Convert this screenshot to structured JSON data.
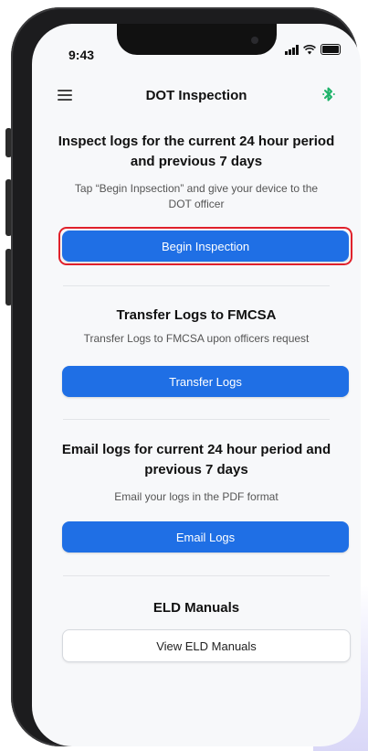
{
  "status_bar": {
    "time": "9:43"
  },
  "header": {
    "title": "DOT Inspection"
  },
  "inspection": {
    "heading": "Inspect logs for the current 24 hour period and previous 7 days",
    "description": "Tap “Begin Inpsection” and give your device to the DOT officer",
    "button_label": "Begin Inspection"
  },
  "transfer": {
    "heading": "Transfer Logs to FMCSA",
    "description": "Transfer Logs to FMCSA upon officers request",
    "button_label": "Transfer Logs"
  },
  "email": {
    "heading": "Email logs for current 24 hour period and previous 7 days",
    "description": "Email your logs in the PDF format",
    "button_label": "Email Logs"
  },
  "manuals": {
    "heading": "ELD Manuals",
    "button_label": "View ELD Manuals"
  },
  "icons": {
    "menu": "hamburger-menu-icon",
    "bluetooth": "bluetooth-icon",
    "signal": "signal-icon",
    "wifi": "wifi-icon",
    "battery": "battery-icon"
  },
  "colors": {
    "primary_button": "#1f6fe5",
    "highlight_border": "#e0212b",
    "bluetooth": "#1fb36a"
  }
}
